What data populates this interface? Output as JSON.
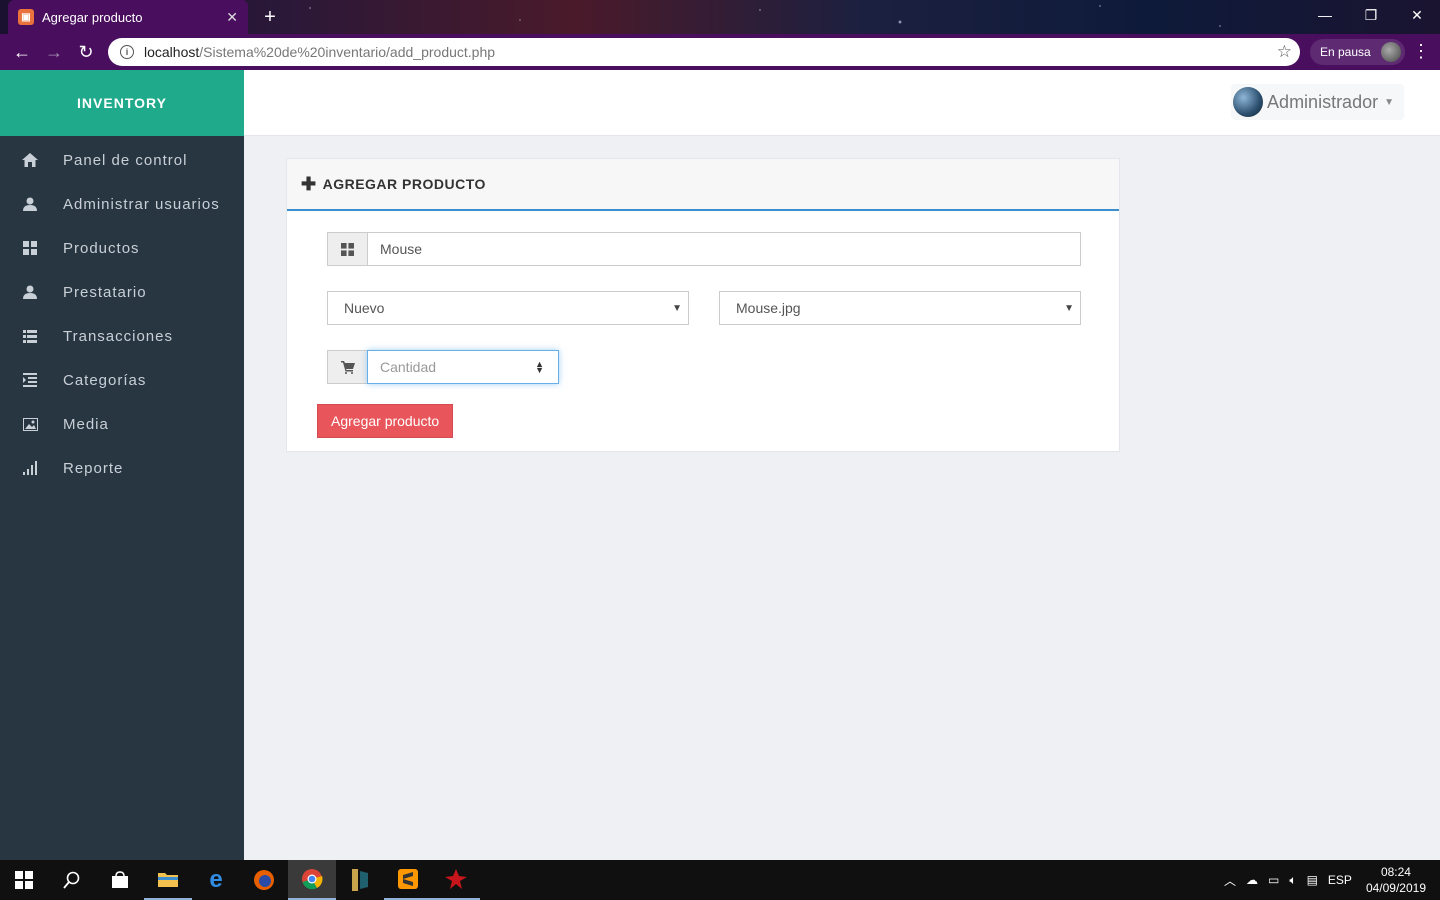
{
  "browser": {
    "tab_title": "Agregar producto",
    "url_host": "localhost",
    "url_path": "/Sistema%20de%20inventario/add_product.php",
    "profile_status": "En pausa"
  },
  "app": {
    "brand": "INVENTORY",
    "user": "Administrador",
    "nav": [
      {
        "label": "Panel de control",
        "icon": "home-icon"
      },
      {
        "label": "Administrar usuarios",
        "icon": "user-icon"
      },
      {
        "label": "Productos",
        "icon": "grid-icon"
      },
      {
        "label": "Prestatario",
        "icon": "user-icon"
      },
      {
        "label": "Transacciones",
        "icon": "list-icon"
      },
      {
        "label": "Categorías",
        "icon": "indent-icon"
      },
      {
        "label": "Media",
        "icon": "picture-icon"
      },
      {
        "label": "Reporte",
        "icon": "signal-icon"
      }
    ]
  },
  "form": {
    "title": "AGREGAR PRODUCTO",
    "product_name": "Mouse",
    "category_selected": "Nuevo",
    "media_selected": "Mouse.jpg",
    "quantity_placeholder": "Cantidad",
    "submit_label": "Agregar producto"
  },
  "taskbar": {
    "language": "ESP",
    "time": "08:24",
    "date": "04/09/2019"
  },
  "colors": {
    "brand": "#1eaa8b",
    "sidebar": "#283642",
    "browser_frame": "#4a0e5e",
    "submit": "#e8555a",
    "focus": "#66afe9"
  }
}
